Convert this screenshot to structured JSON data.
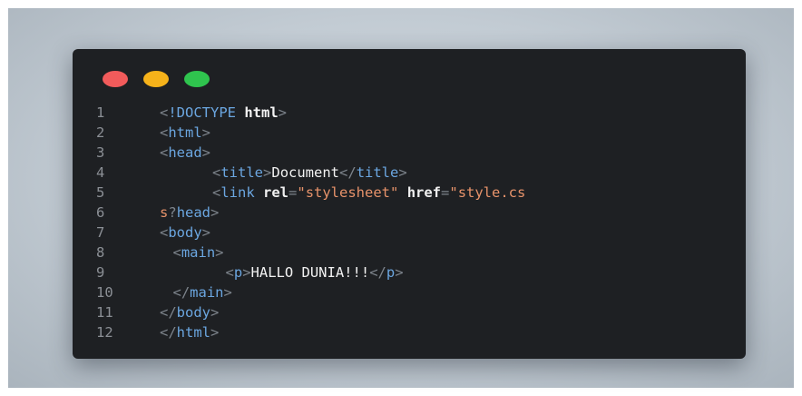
{
  "window": {
    "controls": [
      {
        "name": "close",
        "color": "#f25b5b"
      },
      {
        "name": "minimize",
        "color": "#f6b21a"
      },
      {
        "name": "maximize",
        "color": "#2fc44e"
      }
    ]
  },
  "code": {
    "lines": [
      {
        "n": "1",
        "parts": [
          [
            "punct",
            "<"
          ],
          [
            "kw",
            "!DOCTYPE"
          ],
          [
            "txt",
            " "
          ],
          [
            "bold",
            "html"
          ],
          [
            "punct",
            ">"
          ]
        ]
      },
      {
        "n": "2",
        "parts": [
          [
            "punct",
            "<"
          ],
          [
            "tag",
            "html"
          ],
          [
            "punct",
            ">"
          ]
        ]
      },
      {
        "n": "3",
        "parts": [
          [
            "punct",
            "<"
          ],
          [
            "tag",
            "head"
          ],
          [
            "punct",
            ">"
          ]
        ]
      },
      {
        "n": "4",
        "indent": 1,
        "parts": [
          [
            "punct",
            "<"
          ],
          [
            "tag",
            "title"
          ],
          [
            "punct",
            ">"
          ],
          [
            "txt",
            "Document"
          ],
          [
            "punct",
            "</"
          ],
          [
            "tag",
            "title"
          ],
          [
            "punct",
            ">"
          ]
        ]
      },
      {
        "n": "5",
        "indent": 1,
        "parts": [
          [
            "punct",
            "<"
          ],
          [
            "tag",
            "link"
          ],
          [
            "txt",
            " "
          ],
          [
            "attr",
            "rel"
          ],
          [
            "punct",
            "="
          ],
          [
            "str",
            "\"stylesheet\""
          ],
          [
            "txt",
            " "
          ],
          [
            "attr",
            "href"
          ],
          [
            "punct",
            "="
          ],
          [
            "str",
            "\"style.cs"
          ]
        ]
      },
      {
        "n": "6",
        "parts": [
          [
            "str",
            "s"
          ],
          [
            "punct",
            "?"
          ],
          [
            "tag",
            "head"
          ],
          [
            "punct",
            ">"
          ]
        ]
      },
      {
        "n": "7",
        "parts": [
          [
            "punct",
            "<"
          ],
          [
            "tag",
            "body"
          ],
          [
            "punct",
            ">"
          ]
        ]
      },
      {
        "n": "8",
        "indent": 0.25,
        "parts": [
          [
            "punct",
            "<"
          ],
          [
            "tag",
            "main"
          ],
          [
            "punct",
            ">"
          ]
        ]
      },
      {
        "n": "9",
        "indent": 1.25,
        "parts": [
          [
            "punct",
            "<"
          ],
          [
            "tag",
            "p"
          ],
          [
            "punct",
            ">"
          ],
          [
            "txt",
            "HALLO DUNIA!!!"
          ],
          [
            "punct",
            "</"
          ],
          [
            "tag",
            "p"
          ],
          [
            "punct",
            ">"
          ]
        ]
      },
      {
        "n": "10",
        "indent": 0.25,
        "parts": [
          [
            "punct",
            "</"
          ],
          [
            "tag",
            "main"
          ],
          [
            "punct",
            ">"
          ]
        ]
      },
      {
        "n": "11",
        "parts": [
          [
            "punct",
            "</"
          ],
          [
            "tag",
            "body"
          ],
          [
            "punct",
            ">"
          ]
        ]
      },
      {
        "n": "12",
        "parts": [
          [
            "punct",
            "</"
          ],
          [
            "tag",
            "html"
          ],
          [
            "punct",
            ">"
          ]
        ]
      }
    ]
  }
}
